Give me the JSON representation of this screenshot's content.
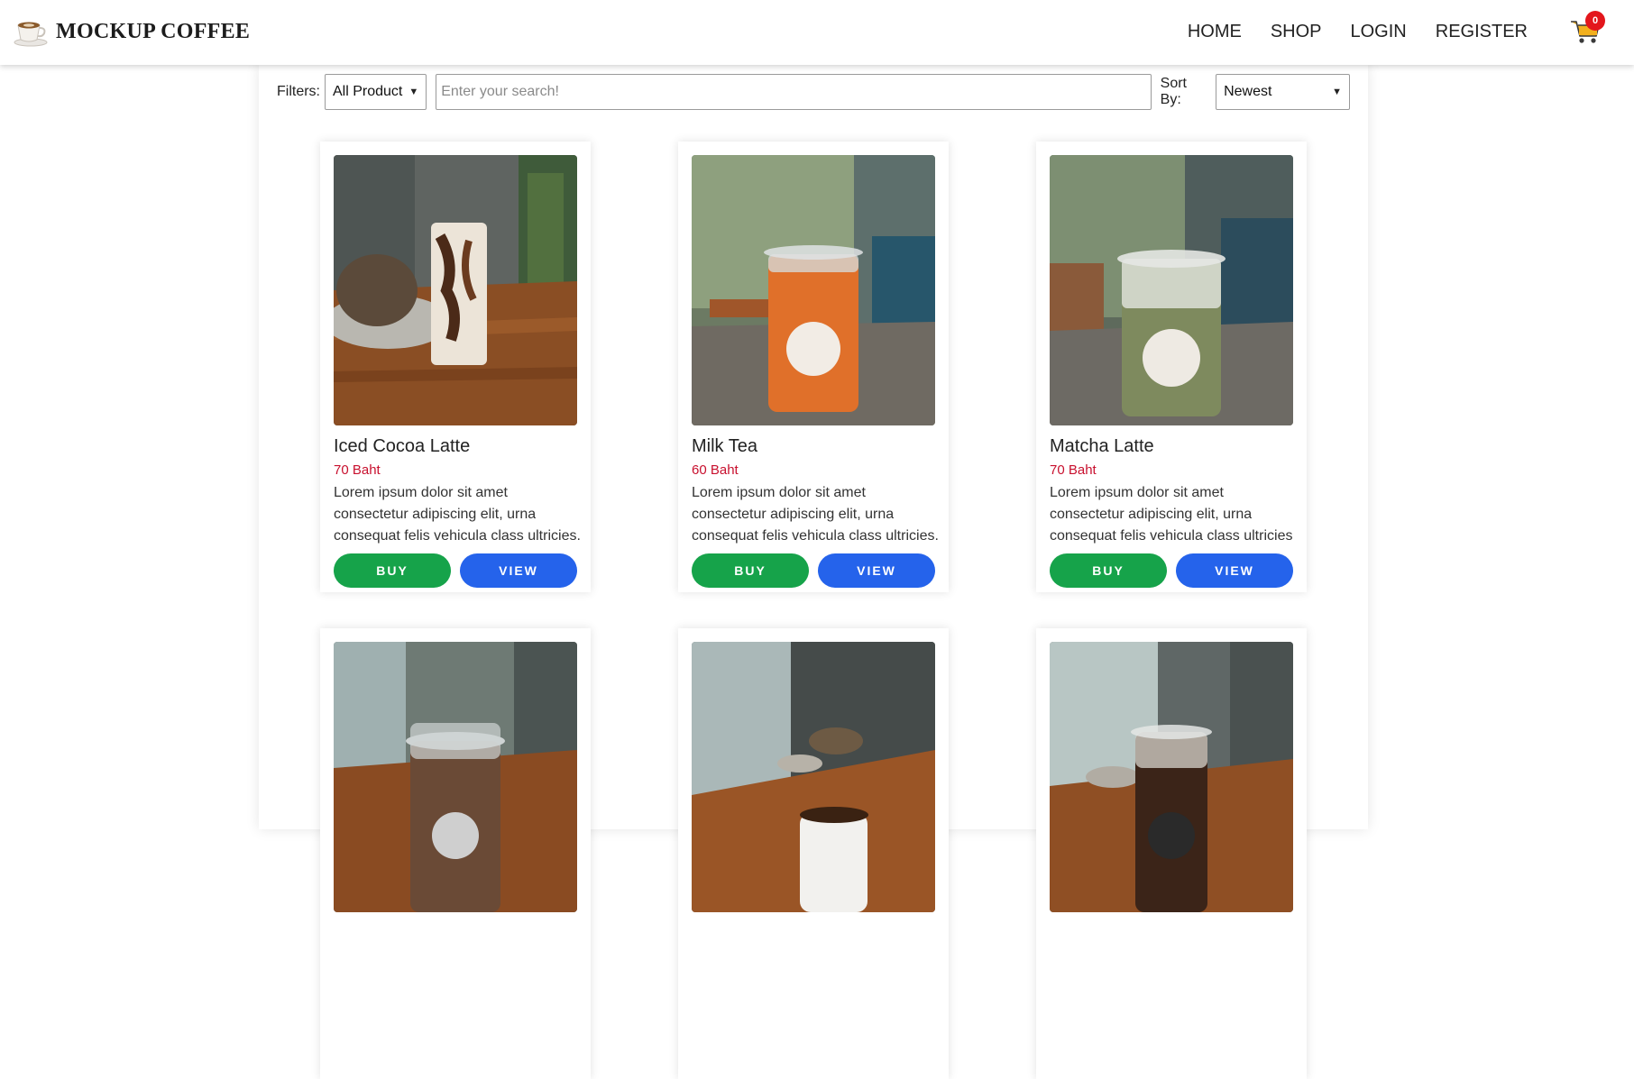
{
  "brand": {
    "name": "MOCKUP COFFEE"
  },
  "nav": {
    "links": [
      "HOME",
      "SHOP",
      "LOGIN",
      "REGISTER"
    ],
    "cart_count": "0"
  },
  "filters": {
    "label": "Filters:",
    "selected": "All Product",
    "search_placeholder": "Enter your search!",
    "sort_label": "Sort By:",
    "sort_selected": "Newest"
  },
  "buttons": {
    "buy": "BUY",
    "view": "VIEW"
  },
  "products": [
    {
      "name": "Iced Cocoa Latte",
      "price": "70 Baht",
      "desc": "Lorem ipsum dolor sit amet consectetur adipiscing elit, urna consequat felis vehicula class ultricies."
    },
    {
      "name": "Milk Tea",
      "price": "60 Baht",
      "desc": "Lorem ipsum dolor sit amet consectetur adipiscing elit, urna consequat felis vehicula class ultricies."
    },
    {
      "name": "Matcha Latte",
      "price": "70 Baht",
      "desc": "Lorem ipsum dolor sit amet consectetur adipiscing elit, urna consequat felis vehicula class ultricies"
    },
    {
      "name": "",
      "price": "",
      "desc": ""
    },
    {
      "name": "",
      "price": "",
      "desc": ""
    },
    {
      "name": "",
      "price": "",
      "desc": ""
    }
  ],
  "colors": {
    "buy": "#16a34a",
    "view": "#2563eb",
    "price": "#c8102e",
    "badge": "#e3161c"
  }
}
